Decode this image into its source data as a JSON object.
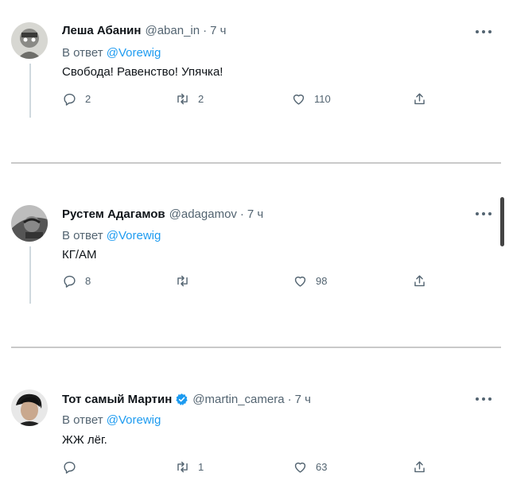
{
  "tweets": [
    {
      "name": "Леша Абанин",
      "handle": "@aban_in",
      "time": "7 ч",
      "reply_prefix": "В ответ",
      "reply_mention": "@Vorewig",
      "text": "Свобода! Равенство! Упячка!",
      "replies": "2",
      "retweets": "2",
      "likes": "110",
      "verified": false
    },
    {
      "name": "Рустем Адагамов",
      "handle": "@adagamov",
      "time": "7 ч",
      "reply_prefix": "В ответ",
      "reply_mention": "@Vorewig",
      "text": "КГ/АМ",
      "replies": "8",
      "retweets": "",
      "likes": "98",
      "verified": false
    },
    {
      "name": "Тот самый Мартин",
      "handle": "@martin_camera",
      "time": "7 ч",
      "reply_prefix": "В ответ",
      "reply_mention": "@Vorewig",
      "text": "ЖЖ лёг.",
      "replies": "",
      "retweets": "1",
      "likes": "63",
      "verified": true
    }
  ],
  "separator": "·",
  "icons": {
    "reply": "reply-icon",
    "retweet": "retweet-icon",
    "like": "heart-icon",
    "share": "share-icon",
    "more": "more-icon",
    "verified": "verified-badge-icon"
  },
  "colors": {
    "mention": "#1d9bf0",
    "secondary": "#536471",
    "verified": "#1d9bf0"
  }
}
